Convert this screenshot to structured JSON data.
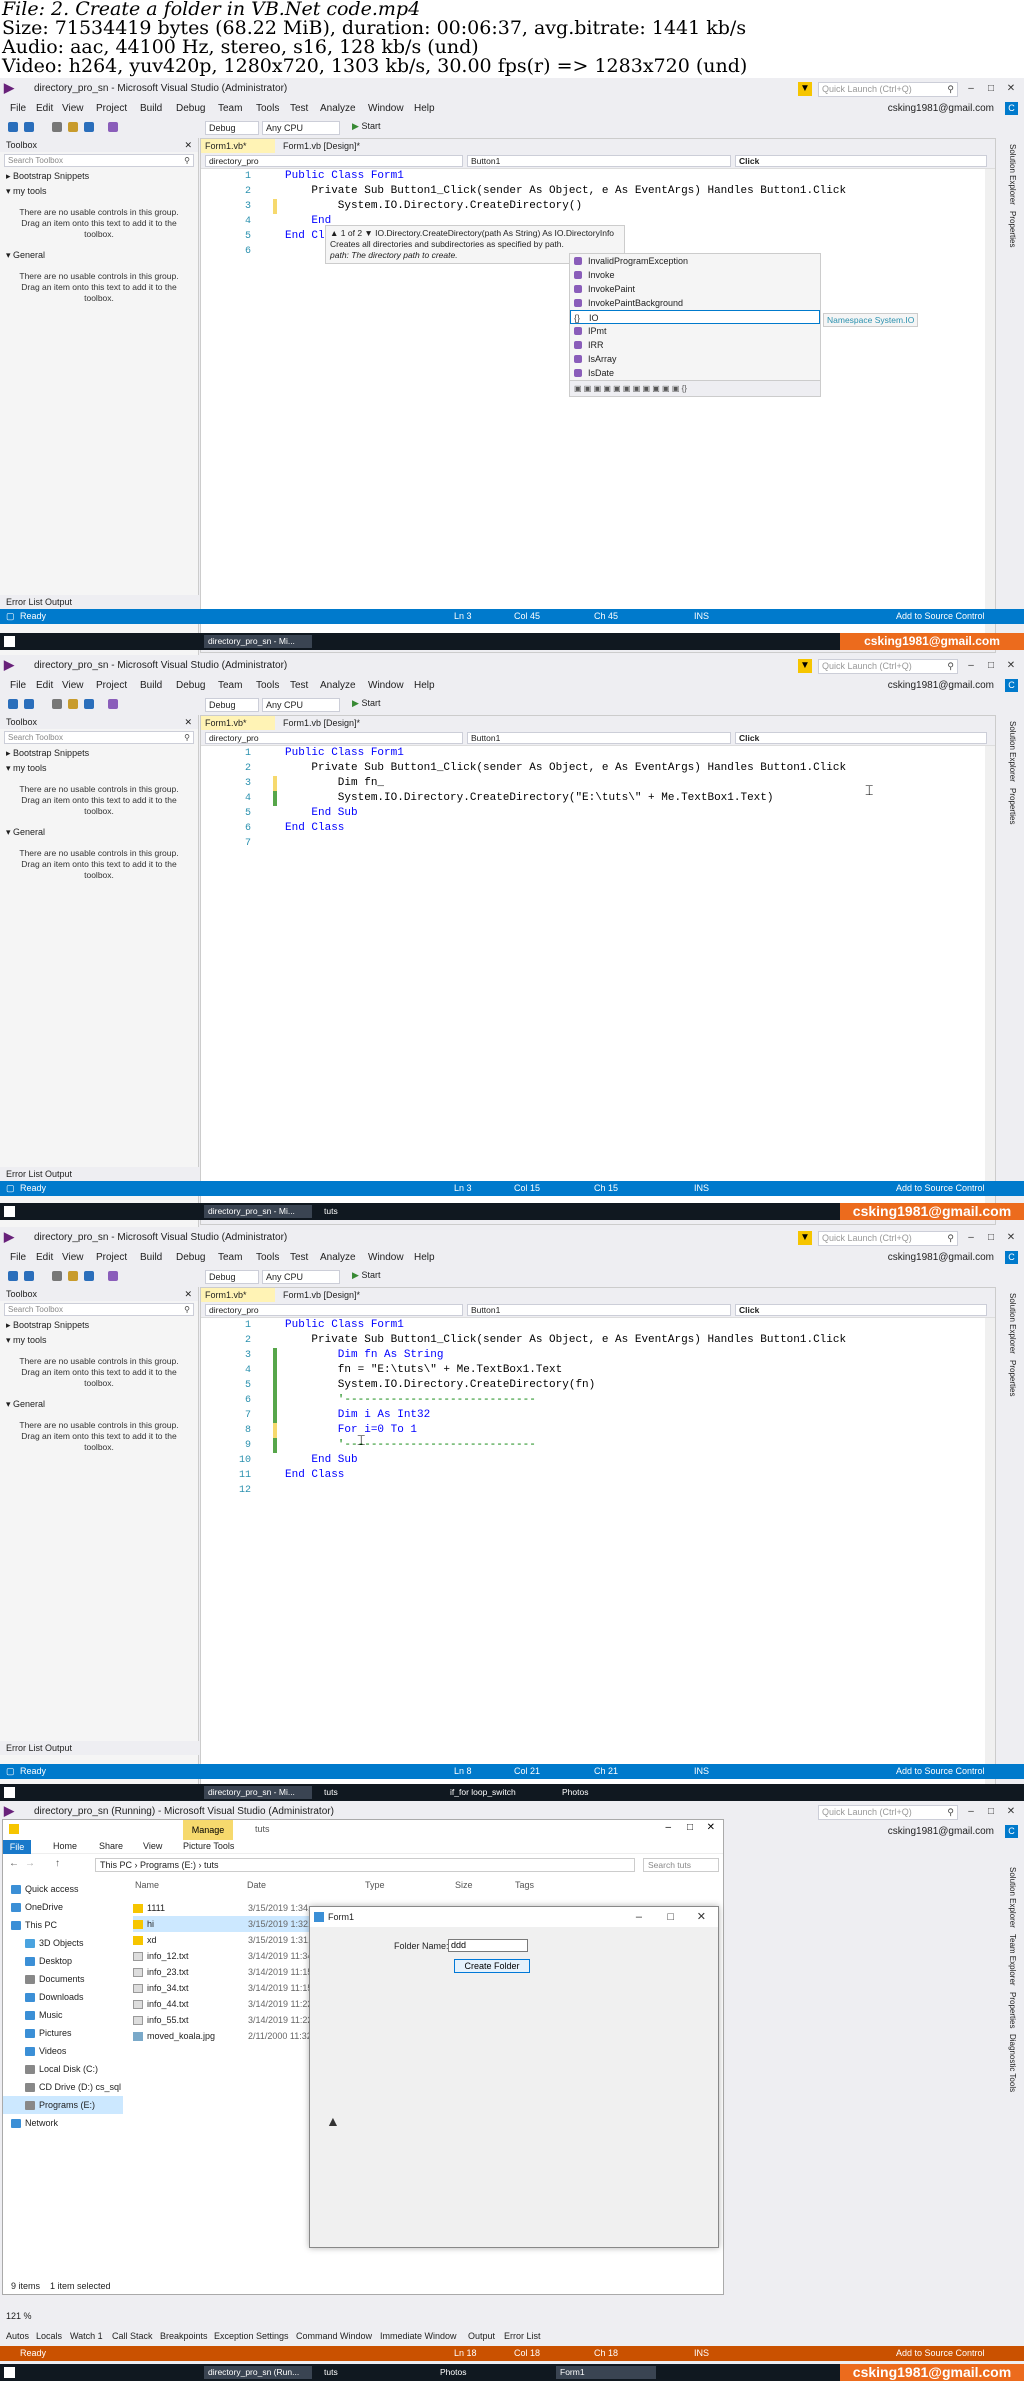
{
  "header": {
    "line1": "File: 2. Create a folder in VB.Net code.mp4",
    "line2": "Size: 71534419 bytes (68.22 MiB), duration: 00:06:37, avg.bitrate: 1441 kb/s",
    "line3": "Audio: aac, 44100 Hz, stereo, s16, 128 kb/s (und)",
    "line4": "Video: h264, yuv420p, 1280x720, 1303 kb/s, 30.00 fps(r) => 1283x720 (und)"
  },
  "common": {
    "window_title": "directory_pro_sn - Microsoft Visual Studio (Administrator)",
    "quick_launch": "Quick Launch (Ctrl+Q)",
    "account": "csking1981@gmail.com",
    "account_initial": "C",
    "menu": [
      "File",
      "Edit",
      "View",
      "Project",
      "Build",
      "Debug",
      "Team",
      "Tools",
      "Test",
      "Analyze",
      "Window",
      "Help"
    ],
    "config": "Debug",
    "platform": "Any CPU",
    "start": "Start",
    "toolbox_title": "Toolbox",
    "toolbox_search": "Search Toolbox",
    "group_bootstrap": "Bootstrap Snippets",
    "group_mytools": "my tools",
    "group_general": "General",
    "empty_msg": "There are no usable controls in this group. Drag an item onto this text to add it to the toolbox.",
    "error_tabs": "Error List   Output",
    "tab_vb": "Form1.vb*",
    "tab_design": "Form1.vb [Design]*",
    "nav_project": "directory_pro",
    "nav_object": "Button1",
    "nav_event": "Click",
    "zoom": "121 %",
    "status_ready": "Ready",
    "status_ins": "INS",
    "source_control": "Add to Source Control",
    "brand": "csking1981@gmail.com",
    "task_vs": "directory_pro_sn - Mi...",
    "task_tuts": "tuts",
    "side_labels": [
      "Solution Explorer",
      "Properties"
    ]
  },
  "frame1": {
    "code": [
      {
        "n": "1",
        "t": "Public Class Form1"
      },
      {
        "n": "2",
        "t": "    Private Sub Button1_Click(sender As Object, e As EventArgs) Handles Button1.Click"
      },
      {
        "n": "3",
        "t": "        System.IO.Directory.CreateDirectory()"
      },
      {
        "n": "4",
        "t": "    End"
      },
      {
        "n": "5",
        "t": "End Class"
      },
      {
        "n": "6",
        "t": ""
      }
    ],
    "tooltip_line1": "▲ 1 of 2 ▼ IO.Directory.CreateDirectory(path As String) As IO.DirectoryInfo",
    "tooltip_line2": "Creates all directories and subdirectories as specified by path.",
    "tooltip_line3": "path: The directory path to create.",
    "autocomplete": [
      "InvalidProgramException",
      "Invoke",
      "InvokePaint",
      "InvokePaintBackground",
      "IO",
      "IPmt",
      "IRR",
      "IsArray",
      "IsDate"
    ],
    "selected_item": "IO",
    "namespace_tip": "Namespace System.IO",
    "status_ln": "Ln 3",
    "status_col": "Col 45",
    "status_ch": "Ch 45"
  },
  "frame2": {
    "code": [
      {
        "n": "1",
        "t": "Public Class Form1"
      },
      {
        "n": "2",
        "t": "    Private Sub Button1_Click(sender As Object, e As EventArgs) Handles Button1.Click"
      },
      {
        "n": "3",
        "t": "        Dim fn_"
      },
      {
        "n": "4",
        "t": "        System.IO.Directory.CreateDirectory(\"E:\\tuts\\\" + Me.TextBox1.Text)"
      },
      {
        "n": "5",
        "t": "    End Sub"
      },
      {
        "n": "6",
        "t": "End Class"
      },
      {
        "n": "7",
        "t": ""
      }
    ],
    "status_ln": "Ln 3",
    "status_col": "Col 15",
    "status_ch": "Ch 15"
  },
  "frame3": {
    "code": [
      {
        "n": "1",
        "t": "Public Class Form1"
      },
      {
        "n": "2",
        "t": "    Private Sub Button1_Click(sender As Object, e As EventArgs) Handles Button1.Click"
      },
      {
        "n": "3",
        "t": "        Dim fn As String"
      },
      {
        "n": "4",
        "t": "        fn = \"E:\\tuts\\\" + Me.TextBox1.Text"
      },
      {
        "n": "5",
        "t": "        System.IO.Directory.CreateDirectory(fn)"
      },
      {
        "n": "6",
        "t": "        '-----------------------------"
      },
      {
        "n": "7",
        "t": "        Dim i As Int32"
      },
      {
        "n": "8",
        "t": "        For i=0 To 1"
      },
      {
        "n": "9",
        "t": "        '-----------------------------"
      },
      {
        "n": "10",
        "t": "    End Sub"
      },
      {
        "n": "11",
        "t": "End Class"
      },
      {
        "n": "12",
        "t": ""
      }
    ],
    "status_ln": "Ln 8",
    "status_col": "Col 21",
    "status_ch": "Ch 21",
    "task_iffor": "if_for loop_switch",
    "task_photos": "Photos"
  },
  "frame4": {
    "window_title": "directory_pro_sn (Running) - Microsoft Visual Studio (Administrator)",
    "explorer_title": "tuts",
    "manage": "Manage",
    "menu": [
      "File",
      "Home",
      "Share",
      "View",
      "Picture Tools"
    ],
    "path": "This PC  ›  Programs (E:)  ›  tuts",
    "search": "Search tuts",
    "nav": [
      "Quick access",
      "OneDrive",
      "This PC",
      "3D Objects",
      "Desktop",
      "Documents",
      "Downloads",
      "Music",
      "Pictures",
      "Videos",
      "Local Disk (C:)",
      "CD Drive (D:) cs_sql",
      "Programs (E:)",
      "Network"
    ],
    "columns": [
      "Name",
      "Date",
      "Type",
      "Size",
      "Tags"
    ],
    "files": [
      {
        "name": "1111",
        "date": "3/15/2019 1:34..."
      },
      {
        "name": "hi",
        "date": "3/15/2019 1:32..."
      },
      {
        "name": "xd",
        "date": "3/15/2019 1:31..."
      },
      {
        "name": "info_12.txt",
        "date": "3/14/2019 11:34..."
      },
      {
        "name": "info_23.txt",
        "date": "3/14/2019 11:15..."
      },
      {
        "name": "info_34.txt",
        "date": "3/14/2019 11:15..."
      },
      {
        "name": "info_44.txt",
        "date": "3/14/2019 11:22..."
      },
      {
        "name": "info_55.txt",
        "date": "3/14/2019 11:22..."
      },
      {
        "name": "moved_koala.jpg",
        "date": "2/11/2000 11:32..."
      }
    ],
    "count": "9 items",
    "selected": "1 item selected",
    "form_title": "Form1",
    "folder_label": "Folder Name:",
    "folder_value": "ddd",
    "create_btn": "Create Folder",
    "zoom": "121 %",
    "bottom_tabs": [
      "Autos",
      "Locals",
      "Watch 1",
      "Call Stack",
      "Breakpoints",
      "Exception Settings",
      "Command Window",
      "Immediate Window",
      "Output",
      "Error List"
    ],
    "status_ln": "Ln 18",
    "status_col": "Col 18",
    "status_ch": "Ch 18",
    "task_vs": "directory_pro_sn (Run...",
    "task_photos": "Photos",
    "task_form": "Form1",
    "side_labels": [
      "Solution Explorer",
      "Team Explorer",
      "Properties",
      "Diagnostic Tools"
    ]
  }
}
